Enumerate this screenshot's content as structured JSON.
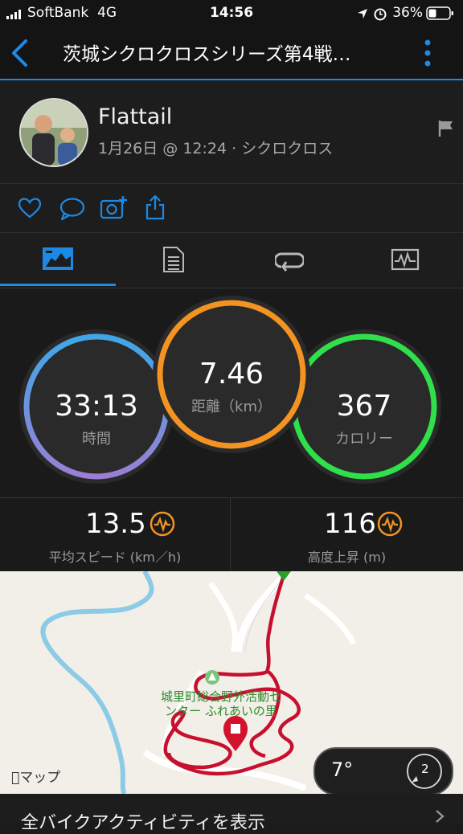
{
  "status_bar": {
    "carrier": "SoftBank",
    "network": "4G",
    "time": "14:56",
    "battery": "36%"
  },
  "header": {
    "title": "茨城シクロクロスシリーズ第4戦…"
  },
  "profile": {
    "name": "Flattail",
    "meta": "1月26日 @ 12:24 · シクロクロス"
  },
  "rings": [
    {
      "value": "33:13",
      "label": "時間"
    },
    {
      "value": "7.46",
      "label": "距離（km）"
    },
    {
      "value": "367",
      "label": "カロリー"
    }
  ],
  "metrics": [
    {
      "value": "13.5",
      "label": "平均スピード (km／h)"
    },
    {
      "value": "116",
      "label": "高度上昇 (m)"
    }
  ],
  "map": {
    "place_label_line1": "城里町総合野外活動セ",
    "place_label_line2": "ンター ふれあいの里",
    "attribution": "マップ",
    "temperature": "7°",
    "wind": "2"
  },
  "footer": {
    "link_text": "全バイクアクティビティを表示"
  },
  "colors": {
    "accent": "#1e88e5",
    "time_ring": "#6f7fd8",
    "distance_ring": "#f39422",
    "calorie_ring": "#2fe04b",
    "route": "#c8102e"
  }
}
